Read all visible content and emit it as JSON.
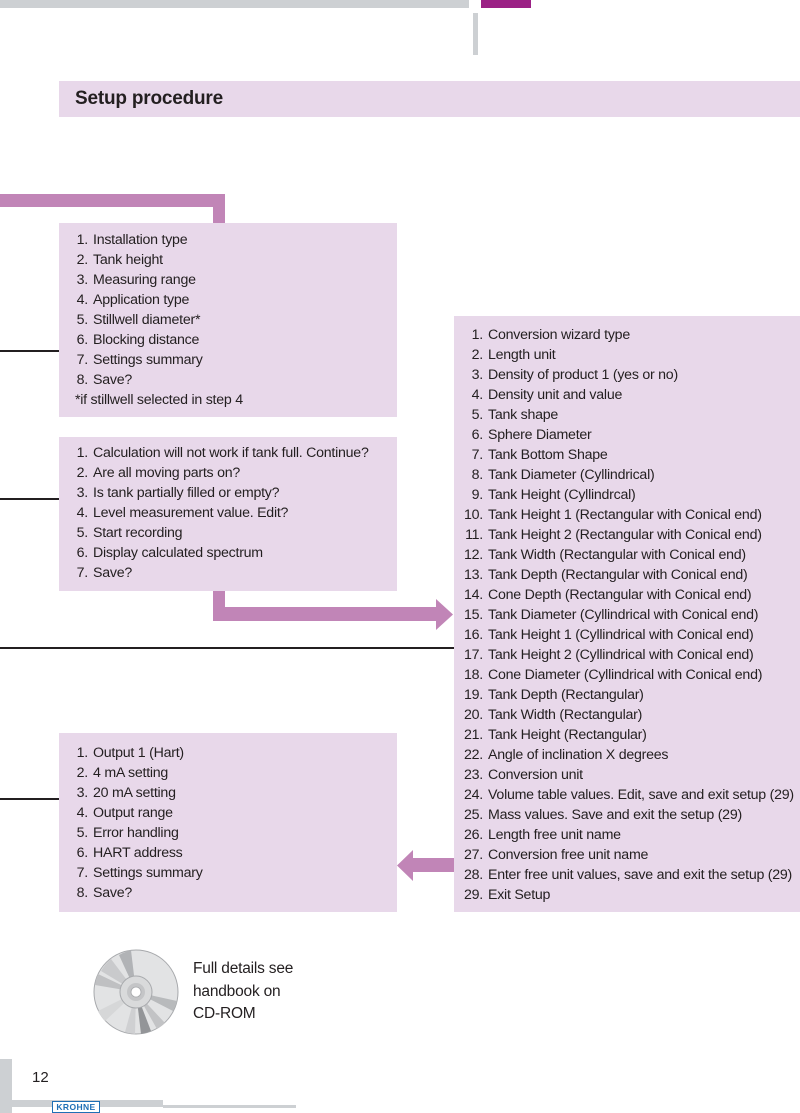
{
  "colors": {
    "accent": "#9b2185",
    "connector": "#c185b7",
    "box_fill": "#e8d8ea",
    "header_bar": "#cdd0d3",
    "rule": "#231f20",
    "brand": "#1f6fb5"
  },
  "header": {
    "section_title": "Setup procedure"
  },
  "boxes": {
    "installation": {
      "items": [
        {
          "n": "1.",
          "text": "Installation type"
        },
        {
          "n": "2.",
          "text": "Tank height"
        },
        {
          "n": "3.",
          "text": "Measuring range"
        },
        {
          "n": "4.",
          "text": "Application type"
        },
        {
          "n": "5.",
          "text": "Stillwell diameter*"
        },
        {
          "n": "6.",
          "text": "Blocking distance"
        },
        {
          "n": "7.",
          "text": "Settings summary"
        },
        {
          "n": "8.",
          "text": "Save?"
        }
      ],
      "footnote": "*if stillwell selected in step 4"
    },
    "empty_spectrum": {
      "items": [
        {
          "n": "1.",
          "text": "Calculation will not work if tank full. Continue?"
        },
        {
          "n": "2.",
          "text": "Are all moving parts on?"
        },
        {
          "n": "3.",
          "text": "Is tank partially filled or empty?"
        },
        {
          "n": "4.",
          "text": "Level measurement value. Edit?"
        },
        {
          "n": "5.",
          "text": "Start recording"
        },
        {
          "n": "6.",
          "text": "Display calculated spectrum"
        },
        {
          "n": "7.",
          "text": "Save?"
        }
      ]
    },
    "outputs": {
      "items": [
        {
          "n": "1.",
          "text": "Output 1 (Hart)"
        },
        {
          "n": "2.",
          "text": "4 mA setting"
        },
        {
          "n": "3.",
          "text": "20 mA setting"
        },
        {
          "n": "4.",
          "text": "Output range"
        },
        {
          "n": "5.",
          "text": "Error handling"
        },
        {
          "n": "6.",
          "text": "HART address"
        },
        {
          "n": "7.",
          "text": "Settings summary"
        },
        {
          "n": "8.",
          "text": "Save?"
        }
      ]
    },
    "conversion": {
      "items": [
        {
          "n": "1.",
          "text": "Conversion wizard type"
        },
        {
          "n": "2.",
          "text": "Length unit"
        },
        {
          "n": "3.",
          "text": "Density of product 1 (yes or no)"
        },
        {
          "n": "4.",
          "text": "Density unit and value"
        },
        {
          "n": "5.",
          "text": "Tank shape"
        },
        {
          "n": "6.",
          "text": "Sphere Diameter"
        },
        {
          "n": "7.",
          "text": "Tank Bottom Shape"
        },
        {
          "n": "8.",
          "text": "Tank Diameter (Cyllindrical)"
        },
        {
          "n": "9.",
          "text": "Tank Height (Cyllindrcal)"
        },
        {
          "n": "10.",
          "text": "Tank Height 1 (Rectangular with Conical end)"
        },
        {
          "n": "11.",
          "text": "Tank Height 2 (Rectangular with Conical end)"
        },
        {
          "n": "12.",
          "text": "Tank Width (Rectangular with Conical end)"
        },
        {
          "n": "13.",
          "text": "Tank Depth (Rectangular with Conical end)"
        },
        {
          "n": "14.",
          "text": "Cone Depth (Rectangular with Conical end)"
        },
        {
          "n": "15.",
          "text": "Tank Diameter (Cyllindrical with Conical end)"
        },
        {
          "n": "16.",
          "text": "Tank Height 1 (Cyllindrical with Conical end)"
        },
        {
          "n": "17.",
          "text": "Tank Height 2 (Cyllindrical with Conical end)"
        },
        {
          "n": "18.",
          "text": "Cone Diameter  (Cyllindrical with Conical end)"
        },
        {
          "n": "19.",
          "text": "Tank Depth (Rectangular)"
        },
        {
          "n": "20.",
          "text": "Tank Width (Rectangular)"
        },
        {
          "n": "21.",
          "text": "Tank Height (Rectangular)"
        },
        {
          "n": "22.",
          "text": "Angle of inclination X degrees"
        },
        {
          "n": "23.",
          "text": "Conversion unit"
        },
        {
          "n": "24.",
          "text": "Volume table values. Edit, save and exit setup (29)"
        },
        {
          "n": "25.",
          "text": "Mass values. Save and exit the setup (29)"
        },
        {
          "n": "26.",
          "text": "Length free unit name"
        },
        {
          "n": "27.",
          "text": "Conversion free unit name"
        },
        {
          "n": "28.",
          "text": "Enter free unit values, save and exit the setup (29)"
        },
        {
          "n": "29.",
          "text": "Exit Setup"
        }
      ]
    }
  },
  "cd_note": {
    "icon": "cd-rom-icon",
    "lines": [
      "Full details see",
      "handbook on",
      "CD-ROM"
    ]
  },
  "footer": {
    "page_number": "12",
    "brand": "KROHNE"
  }
}
